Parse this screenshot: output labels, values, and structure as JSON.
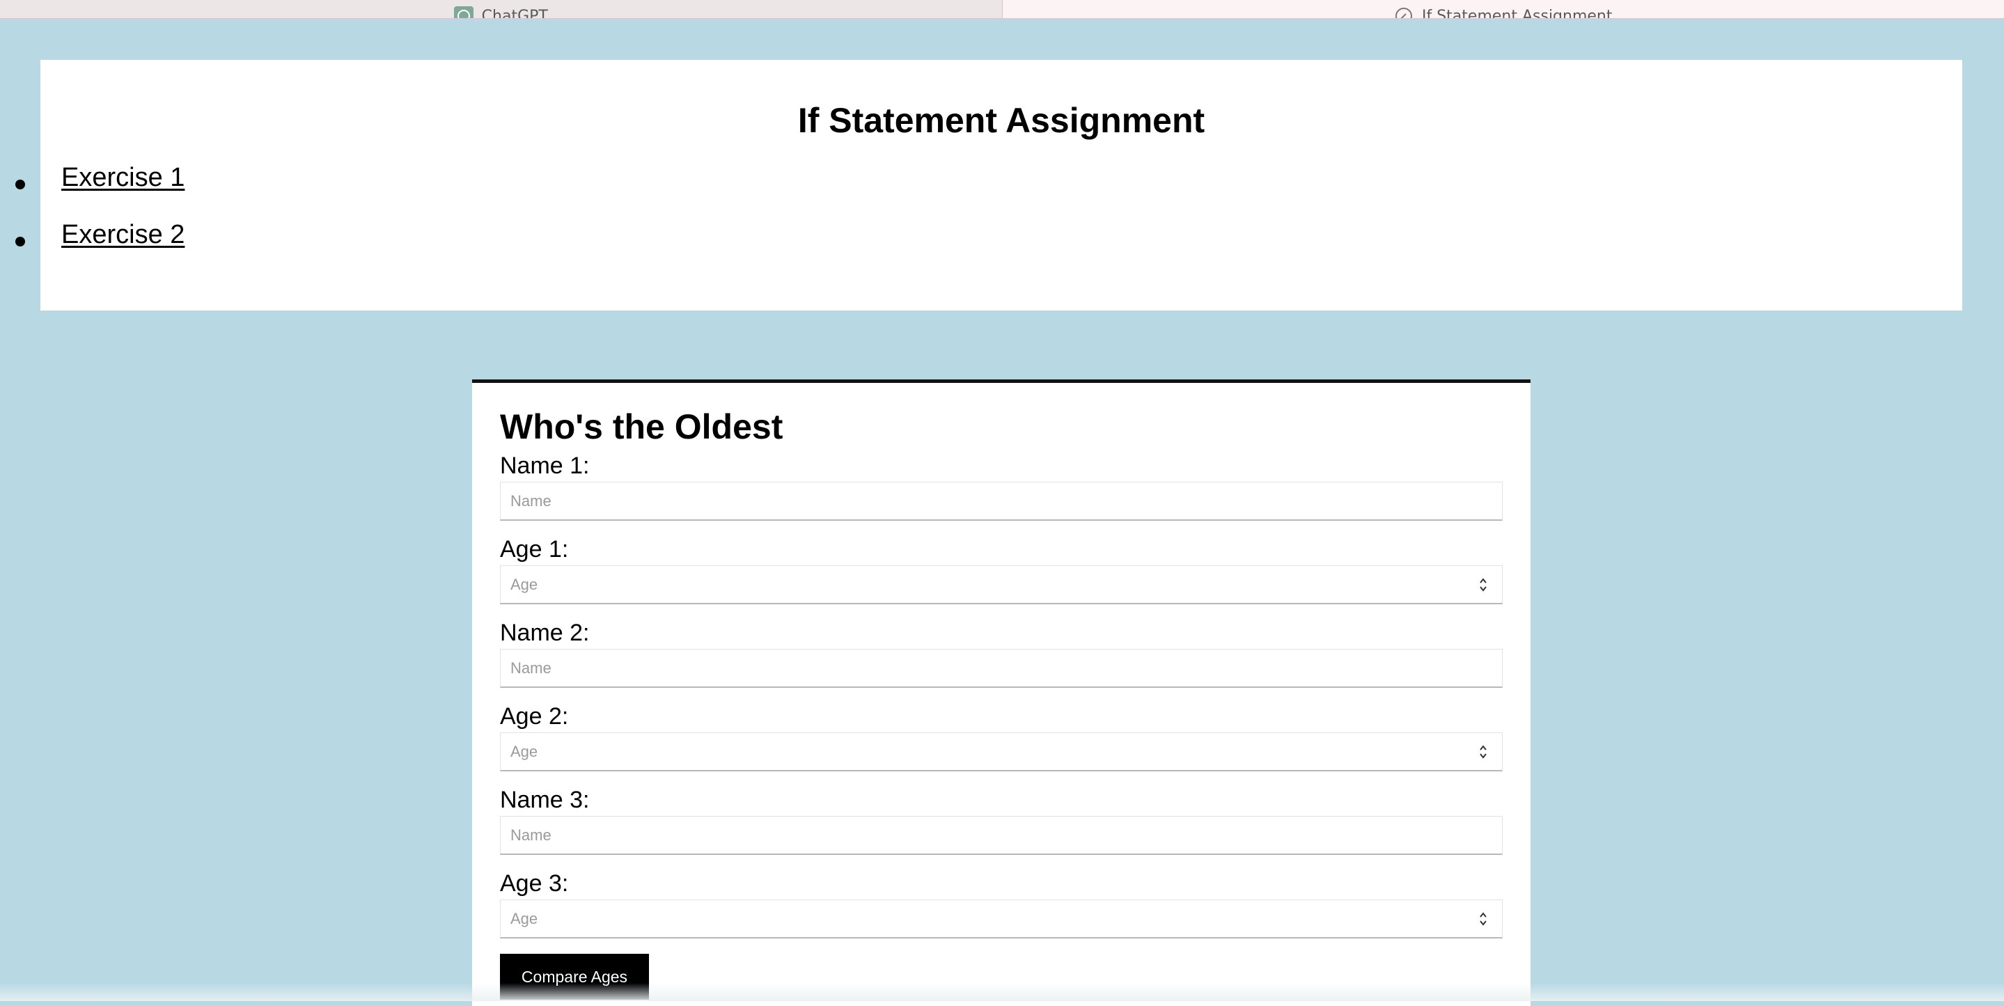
{
  "browser": {
    "tabs": [
      {
        "label": "ChatGPT",
        "icon": "chatgpt-logo-icon",
        "active": false
      },
      {
        "label": "If Statement Assignment",
        "icon": "page-globe-icon",
        "active": true
      }
    ]
  },
  "header": {
    "title": "If Statement Assignment",
    "links": [
      {
        "label": "Exercise 1"
      },
      {
        "label": "Exercise 2"
      }
    ]
  },
  "form": {
    "title": "Who's the Oldest",
    "fields": [
      {
        "label": "Name 1:",
        "placeholder": "Name",
        "type": "text",
        "value": ""
      },
      {
        "label": "Age 1:",
        "placeholder": "Age",
        "type": "number",
        "value": ""
      },
      {
        "label": "Name 2:",
        "placeholder": "Name",
        "type": "text",
        "value": ""
      },
      {
        "label": "Age 2:",
        "placeholder": "Age",
        "type": "number",
        "value": ""
      },
      {
        "label": "Name 3:",
        "placeholder": "Name",
        "type": "text",
        "value": ""
      },
      {
        "label": "Age 3:",
        "placeholder": "Age",
        "type": "number",
        "value": ""
      }
    ],
    "submit_label": "Compare Ages"
  },
  "colors": {
    "page_background": "#b8d9e4",
    "card_background": "#ffffff",
    "button_background": "#000000",
    "button_text": "#ffffff"
  }
}
